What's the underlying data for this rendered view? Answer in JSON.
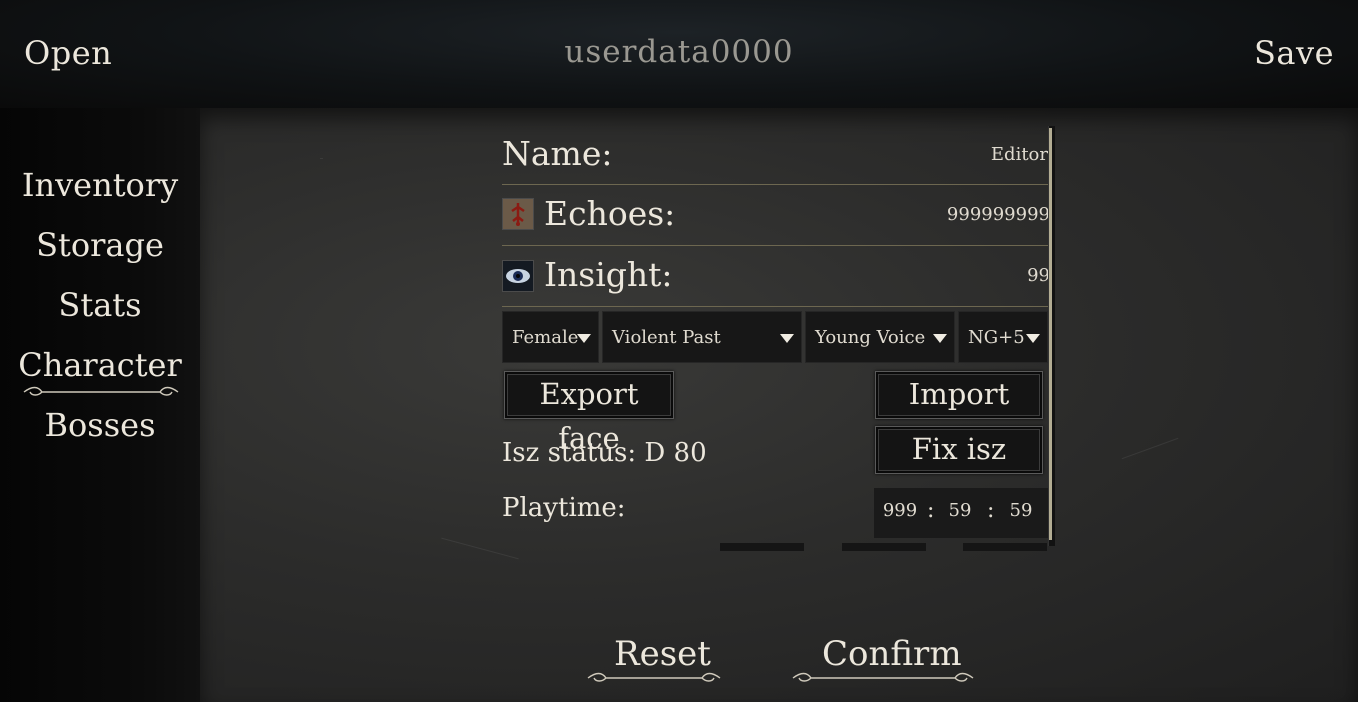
{
  "topbar": {
    "open_label": "Open",
    "title": "userdata0000",
    "save_label": "Save"
  },
  "sidebar": {
    "items": [
      {
        "label": "Inventory",
        "active": false
      },
      {
        "label": "Storage",
        "active": false
      },
      {
        "label": "Stats",
        "active": false
      },
      {
        "label": "Character",
        "active": true
      },
      {
        "label": "Bosses",
        "active": false
      }
    ]
  },
  "character": {
    "name_label": "Name:",
    "name_value": "Editor",
    "echoes_label": "Echoes:",
    "echoes_value": "999999999",
    "insight_label": "Insight:",
    "insight_value": "99",
    "dropdowns": {
      "gender": "Female",
      "origin": "Violent Past",
      "voice": "Young Voice",
      "ng": "NG+5"
    },
    "export_face_label": "Export face",
    "import_face_label": "Import face",
    "isz_status": "Isz status: D 80",
    "fix_isz_label": "Fix isz",
    "playtime_label": "Playtime:",
    "playtime": {
      "hours": "999",
      "minutes": "59",
      "seconds": "59",
      "separator": ":"
    }
  },
  "footer": {
    "reset_label": "Reset",
    "confirm_label": "Confirm"
  },
  "icons": {
    "echoes": "blood-echo-icon",
    "insight": "eye-icon"
  },
  "colors": {
    "text": "#ece7dc",
    "accent_line": "#6d6750",
    "title_gray": "#9a9891"
  }
}
